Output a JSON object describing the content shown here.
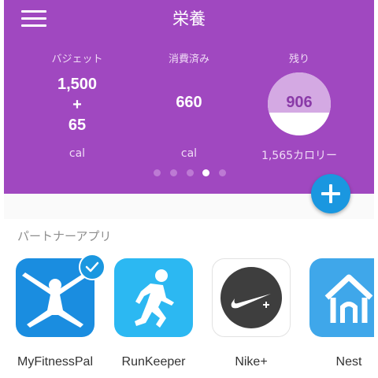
{
  "header": {
    "title": "栄養",
    "menu_icon": "menu-icon",
    "background": "#a048c0"
  },
  "summary": {
    "budget": {
      "label": "バジェット",
      "line1": "1,500",
      "line2": "+",
      "line3": "65",
      "unit": "cal"
    },
    "consumed": {
      "label": "消費済み",
      "value": "660",
      "unit": "cal"
    },
    "remaining": {
      "label": "残り",
      "value": "906",
      "unit": "1,565カロリー"
    }
  },
  "pager": {
    "count": 5,
    "active_index": 3
  },
  "fab": {
    "icon": "plus-icon",
    "color": "#1a97e0"
  },
  "partners": {
    "section_title": "パートナーアプリ",
    "apps": [
      {
        "name": "MyFitnessPal",
        "icon": "myfitnesspal-icon",
        "connected": true
      },
      {
        "name": "RunKeeper",
        "icon": "runkeeper-icon",
        "connected": false
      },
      {
        "name": "Nike+",
        "icon": "nike-plus-icon",
        "connected": false
      },
      {
        "name": "Nest",
        "icon": "nest-icon",
        "connected": false
      }
    ]
  }
}
